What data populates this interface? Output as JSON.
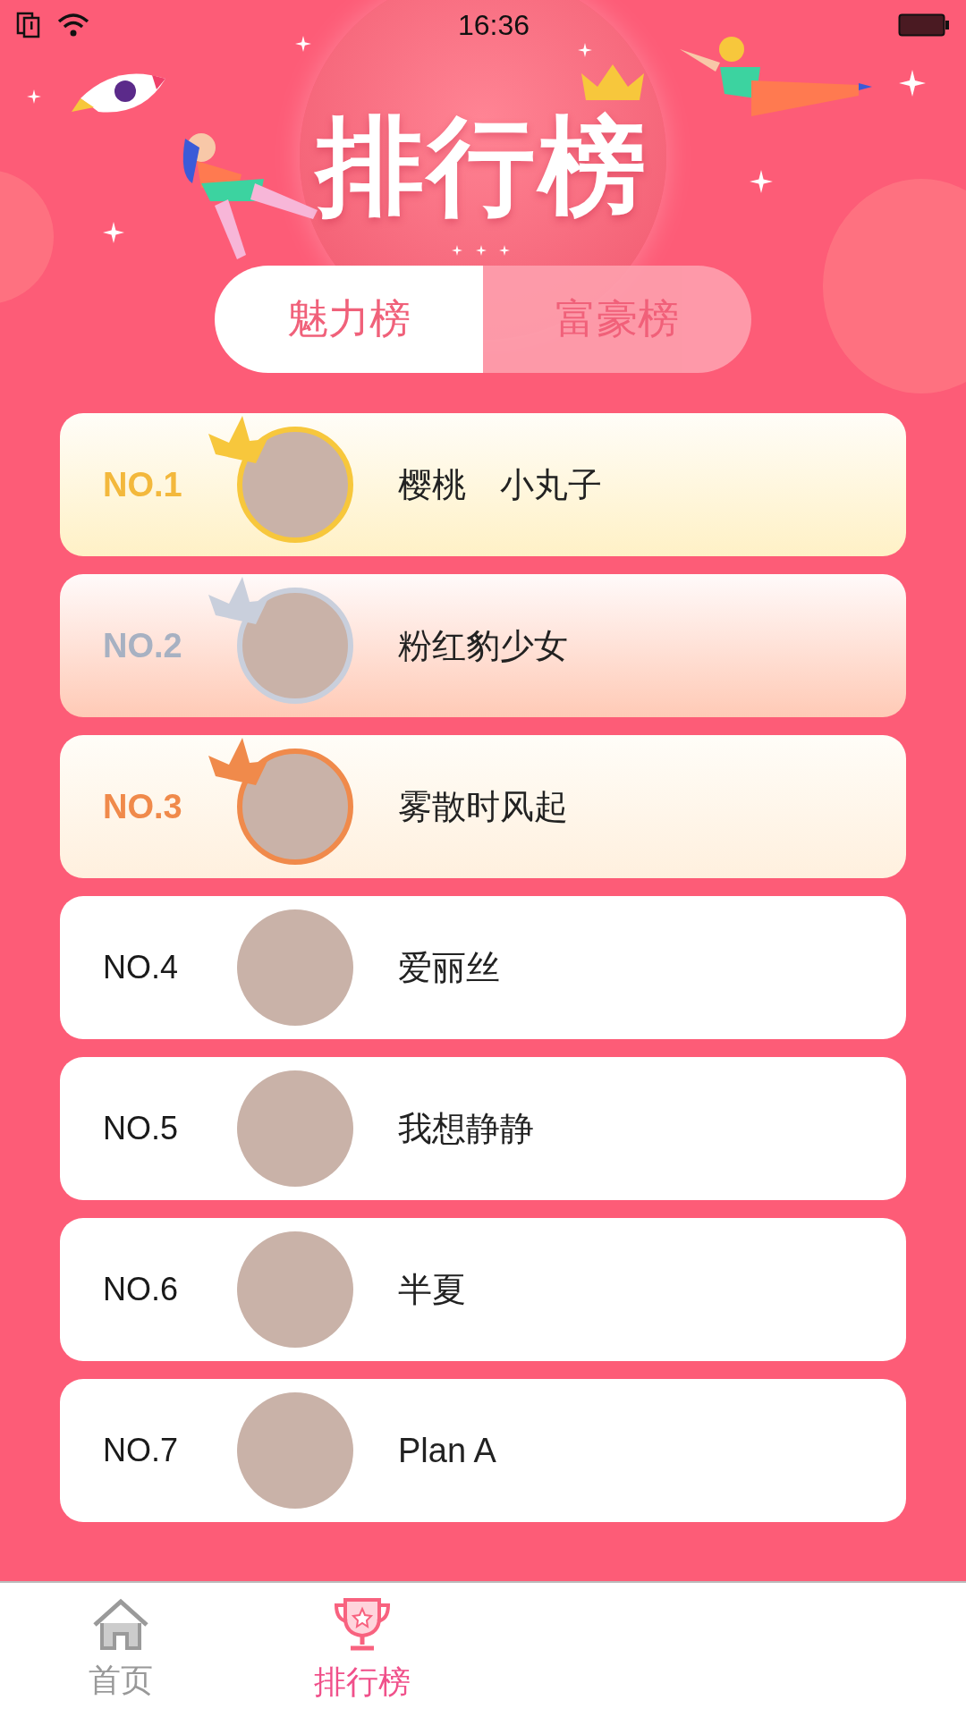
{
  "status_bar": {
    "time": "16:36"
  },
  "header": {
    "title": "排行榜"
  },
  "tabs": [
    {
      "label": "魅力榜",
      "selected": true
    },
    {
      "label": "富豪榜",
      "selected": false
    }
  ],
  "ranking": [
    {
      "rank": "NO.1",
      "name": "樱桃　小丸子",
      "kind": "gold"
    },
    {
      "rank": "NO.2",
      "name": "粉红豹少女",
      "kind": "silver"
    },
    {
      "rank": "NO.3",
      "name": "雾散时风起",
      "kind": "bronze"
    },
    {
      "rank": "NO.4",
      "name": "爱丽丝",
      "kind": "plain"
    },
    {
      "rank": "NO.5",
      "name": "我想静静",
      "kind": "plain"
    },
    {
      "rank": "NO.6",
      "name": "半夏",
      "kind": "plain"
    },
    {
      "rank": "NO.7",
      "name": "Plan A",
      "kind": "plain"
    }
  ],
  "bottom_nav": [
    {
      "label": "首页",
      "kind": "home",
      "selected": false
    },
    {
      "label": "排行榜",
      "kind": "trophy",
      "selected": true
    }
  ]
}
